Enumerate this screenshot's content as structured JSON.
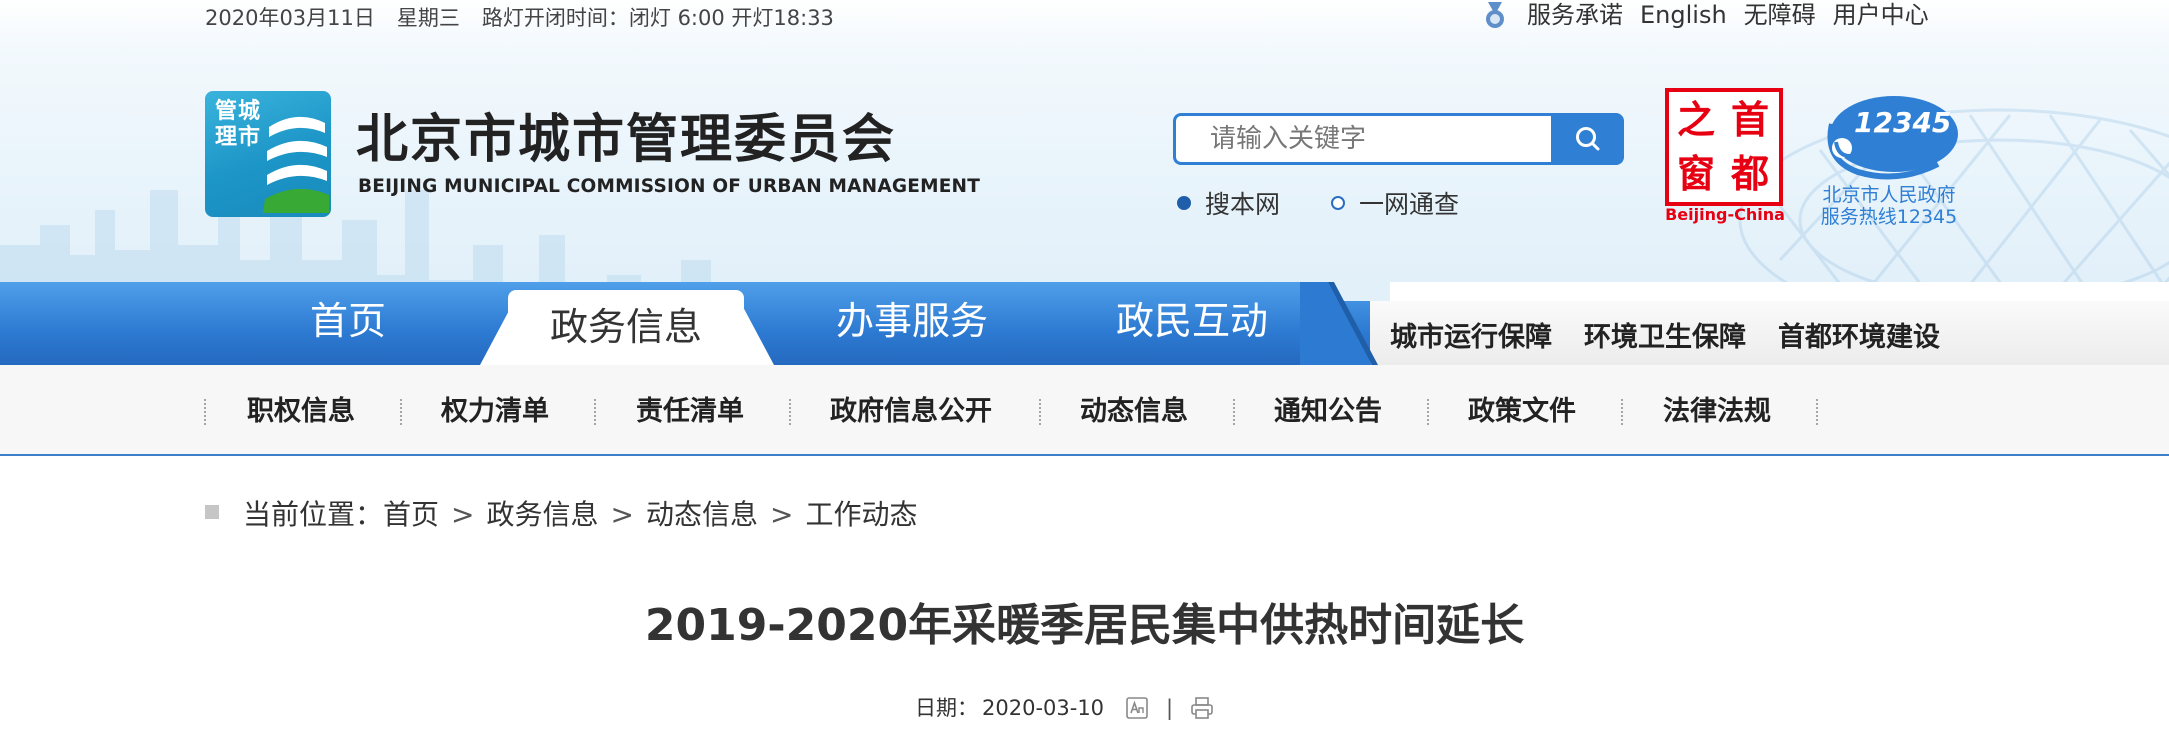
{
  "topbar": {
    "date": "2020年03月11日",
    "weekday": "星期三",
    "streetlight": "路灯开闭时间：闭灯 6:00 开灯18:33",
    "links": [
      "服务承诺",
      "English",
      "无障碍",
      "用户中心"
    ]
  },
  "logo": {
    "emblem_text_line1": "管城",
    "emblem_text_line2": "理市",
    "title": "北京市城市管理委员会",
    "subtitle": "BEIJING MUNICIPAL COMMISSION OF URBAN MANAGEMENT"
  },
  "search": {
    "placeholder": "请输入关键字",
    "scope_options": [
      "搜本网",
      "一网通查"
    ],
    "selected_scope": "搜本网"
  },
  "seals": {
    "capital_chars": [
      "之",
      "首",
      "窗",
      "都"
    ],
    "capital_label": "Beijing-China",
    "hotline_number": "12345",
    "hotline_line1": "北京市人民政府",
    "hotline_line2": "服务热线12345"
  },
  "main_nav": {
    "items": [
      "首页",
      "政务信息",
      "办事服务",
      "政民互动"
    ],
    "active": "政务信息",
    "secondary_links": [
      "城市运行保障",
      "环境卫生保障",
      "首都环境建设"
    ]
  },
  "sub_nav": {
    "items": [
      "职权信息",
      "权力清单",
      "责任清单",
      "政府信息公开",
      "动态信息",
      "通知公告",
      "政策文件",
      "法律法规"
    ]
  },
  "breadcrumb": {
    "label": "当前位置：",
    "items": [
      "首页",
      "政务信息",
      "动态信息",
      "工作动态"
    ],
    "separator": ">"
  },
  "article": {
    "title": "2019-2020年采暖季居民集中供热时间延长",
    "date_label": "日期：",
    "date": "2020-03-10",
    "divider": "|"
  },
  "colors": {
    "primary_blue": "#2f7fd5",
    "nav_blue": "#2d7ad2",
    "seal_red": "#e60012",
    "logo_teal": "#1c95c7",
    "logo_green": "#39a935"
  },
  "icons": {
    "topbar": "medal-icon",
    "search": "search-icon",
    "font_size": "font-size-icon",
    "print": "print-icon"
  }
}
